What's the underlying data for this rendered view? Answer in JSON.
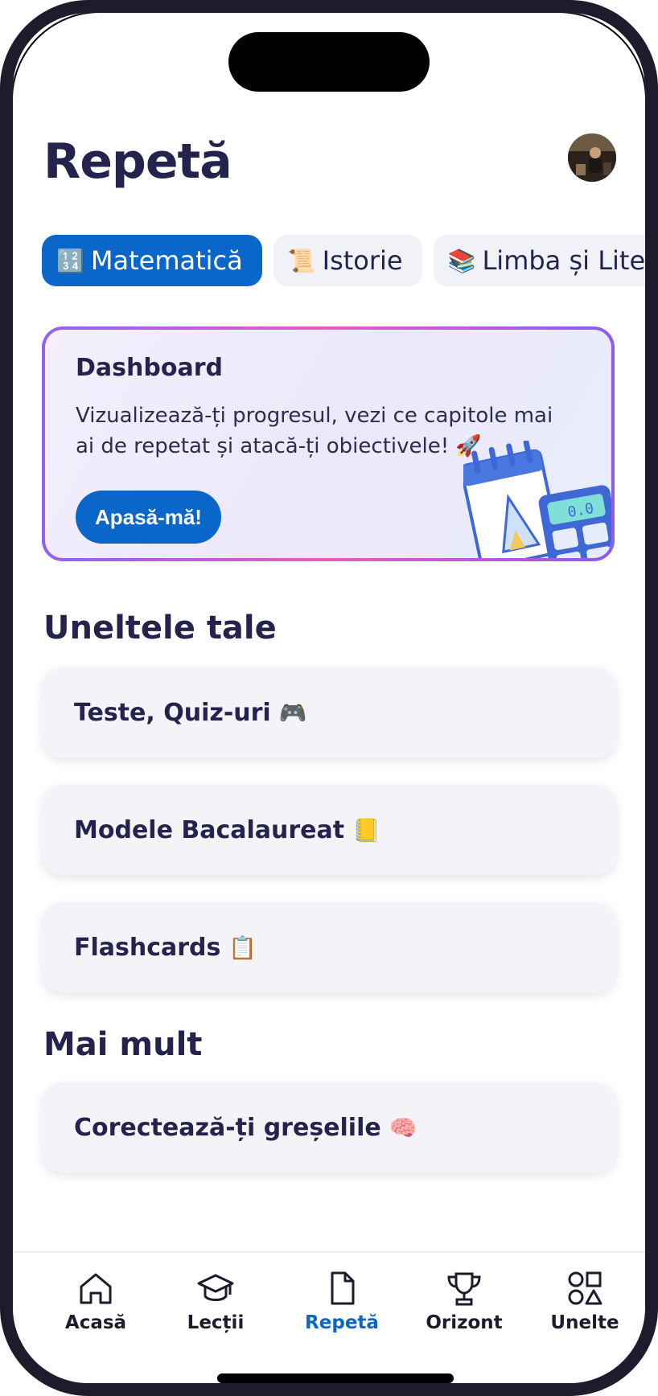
{
  "header": {
    "title": "Repetă",
    "avatar_icon": "user-avatar"
  },
  "subjects": [
    {
      "emoji": "🔢",
      "label": "Matematică",
      "active": true
    },
    {
      "emoji": "📜",
      "label": "Istorie",
      "active": false
    },
    {
      "emoji": "📚",
      "label": "Limba și Liter",
      "active": false
    }
  ],
  "dashboard": {
    "title": "Dashboard",
    "description": "Vizualizează-ți progresul, vezi ce capitole mai ai de repetat și atacă-ți obiectivele! 🚀",
    "button_label": "Apasă-mă!",
    "illustration": "calendar-calculator-illustration",
    "calculator_display": "0.0"
  },
  "tools_section": {
    "title": "Uneltele tale",
    "items": [
      {
        "label": "Teste, Quiz-uri",
        "emoji": "🎮"
      },
      {
        "label": "Modele Bacalaureat",
        "emoji": "📒"
      },
      {
        "label": "Flashcards",
        "emoji": "📋"
      }
    ]
  },
  "more_section": {
    "title": "Mai mult",
    "items": [
      {
        "label": "Corectează-ți greșelile",
        "emoji": "🧠"
      }
    ]
  },
  "bottom_nav": {
    "items": [
      {
        "label": "Acasă",
        "icon": "home-icon",
        "active": false
      },
      {
        "label": "Lecții",
        "icon": "graduation-cap-icon",
        "active": false
      },
      {
        "label": "Repetă",
        "icon": "document-icon",
        "active": true
      },
      {
        "label": "Orizont",
        "icon": "trophy-icon",
        "active": false
      },
      {
        "label": "Unelte",
        "icon": "shapes-icon",
        "active": false
      }
    ]
  },
  "colors": {
    "primary": "#0a66c8",
    "text_dark": "#25234d",
    "card_bg": "#f4f4f8",
    "gradient_border": [
      "#8f62f2",
      "#e75bc2"
    ]
  }
}
